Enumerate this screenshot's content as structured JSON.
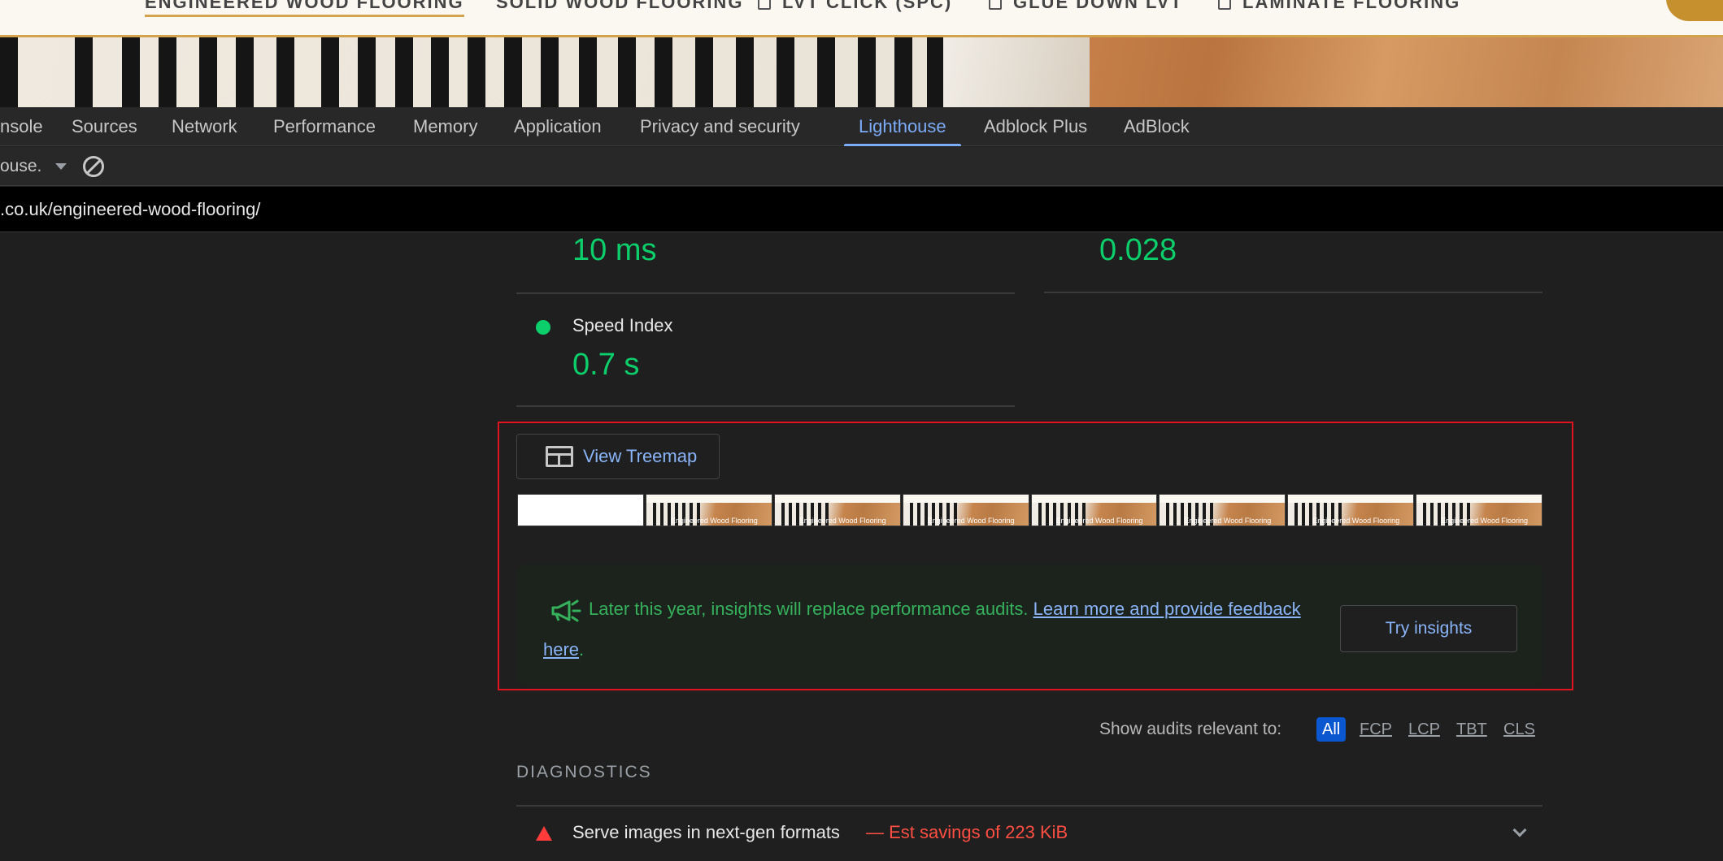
{
  "site": {
    "nav": [
      {
        "label": "ENGINEERED WOOD FLOORING",
        "active": true
      },
      {
        "label": "SOLID WOOD FLOORING",
        "active": false
      },
      {
        "label": "LVT CLICK (SPC)",
        "active": false
      },
      {
        "label": "GLUE DOWN LVT",
        "active": false
      },
      {
        "label": "LAMINATE FLOORING",
        "active": false
      }
    ],
    "accent_color": "#d2a24c"
  },
  "devtools": {
    "tabs": [
      "nsole",
      "Sources",
      "Network",
      "Performance",
      "Memory",
      "Application",
      "Privacy and security",
      "Lighthouse",
      "Adblock Plus",
      "AdBlock"
    ],
    "active_tab": "Lighthouse",
    "toolbar": {
      "select_value": "ouse.",
      "clear_icon": "clear-icon"
    },
    "url": ".co.uk/engineered-wood-flooring/"
  },
  "report": {
    "metrics": [
      {
        "value": "10 ms"
      },
      {
        "value": "0.028"
      },
      {
        "title": "Speed Index",
        "value": "0.7 s"
      }
    ],
    "treemap_button": "View Treemap",
    "filmstrip_caption": "Engineered Wood Flooring",
    "insights": {
      "text": "Later this year, insights will replace performance audits. ",
      "link": "Learn more and provide feedback here",
      "suffix": ".",
      "button": "Try insights"
    },
    "filter": {
      "label": "Show audits relevant to:",
      "chips": [
        "All",
        "FCP",
        "LCP",
        "TBT",
        "CLS"
      ],
      "active": "All"
    },
    "diagnostics": {
      "title": "DIAGNOSTICS",
      "audits": [
        {
          "title": "Serve images in next-gen formats",
          "savings": "— Est savings of 223 KiB",
          "status": "fail"
        }
      ]
    },
    "colors": {
      "pass": "#0cce6b",
      "fail": "#ff4e42",
      "link": "#8ab4f8",
      "highlight": "#e0141e"
    }
  }
}
